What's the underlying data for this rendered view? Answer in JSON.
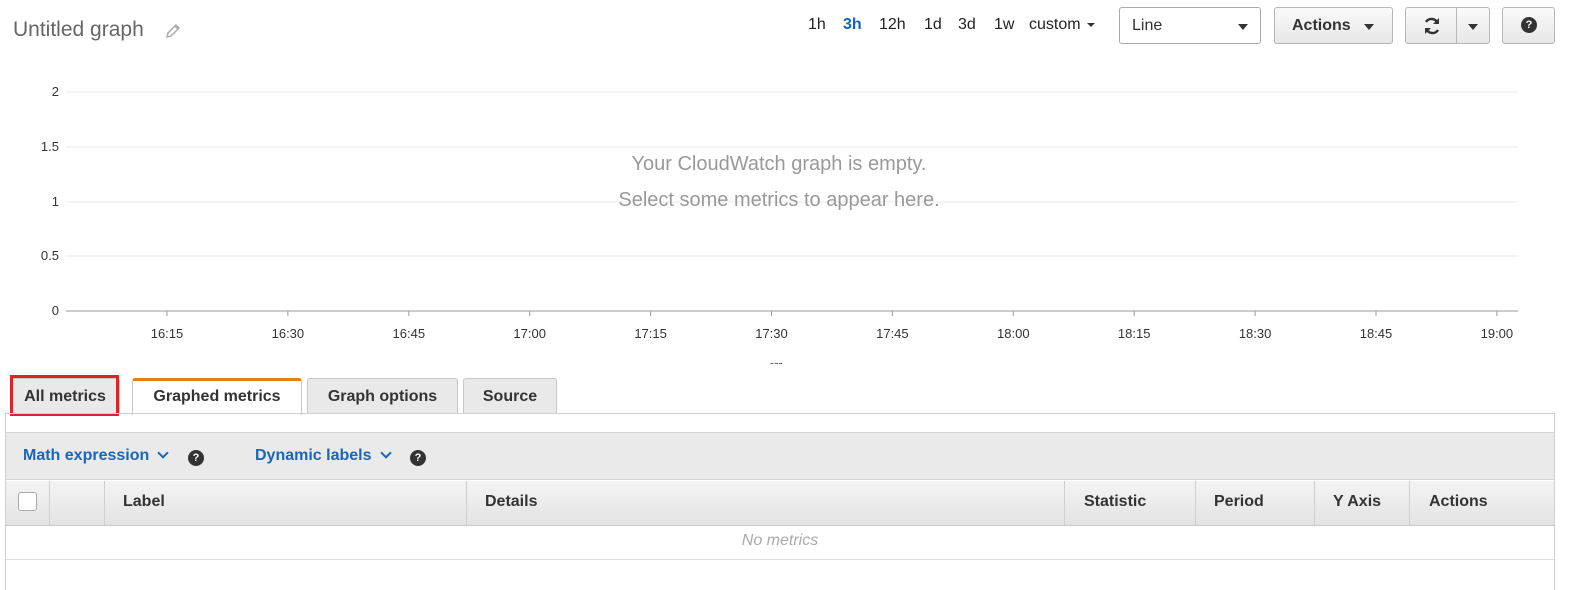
{
  "header": {
    "title": "Untitled graph",
    "time_ranges": [
      "1h",
      "3h",
      "12h",
      "1d",
      "3d",
      "1w"
    ],
    "active_range": "3h",
    "custom_label": "custom",
    "chart_type": "Line",
    "actions_label": "Actions"
  },
  "chart_data": {
    "type": "line",
    "series": [],
    "x_ticks": [
      "16:15",
      "16:30",
      "16:45",
      "17:00",
      "17:15",
      "17:30",
      "17:45",
      "18:00",
      "18:15",
      "18:30",
      "18:45",
      "19:00"
    ],
    "y_ticks": [
      "2",
      "1.5",
      "1",
      "0.5",
      "0"
    ],
    "ylim": [
      0,
      2
    ],
    "grid": true,
    "empty_line1": "Your CloudWatch graph is empty.",
    "empty_line2": "Select some metrics to appear here.",
    "legend_text": "---"
  },
  "tabs": [
    {
      "label": "All metrics"
    },
    {
      "label": "Graphed metrics"
    },
    {
      "label": "Graph options"
    },
    {
      "label": "Source"
    }
  ],
  "toolbar": {
    "math_expression": "Math expression",
    "dynamic_labels": "Dynamic labels",
    "help_glyph": "?"
  },
  "table": {
    "columns": [
      "Label",
      "Details",
      "Statistic",
      "Period",
      "Y Axis",
      "Actions"
    ],
    "empty_text": "No metrics"
  },
  "colors": {
    "accent_link": "#1a66b8",
    "active_tab_border": "#e5820b",
    "highlight_box": "#d9262c",
    "active_range": "#1166bb"
  }
}
